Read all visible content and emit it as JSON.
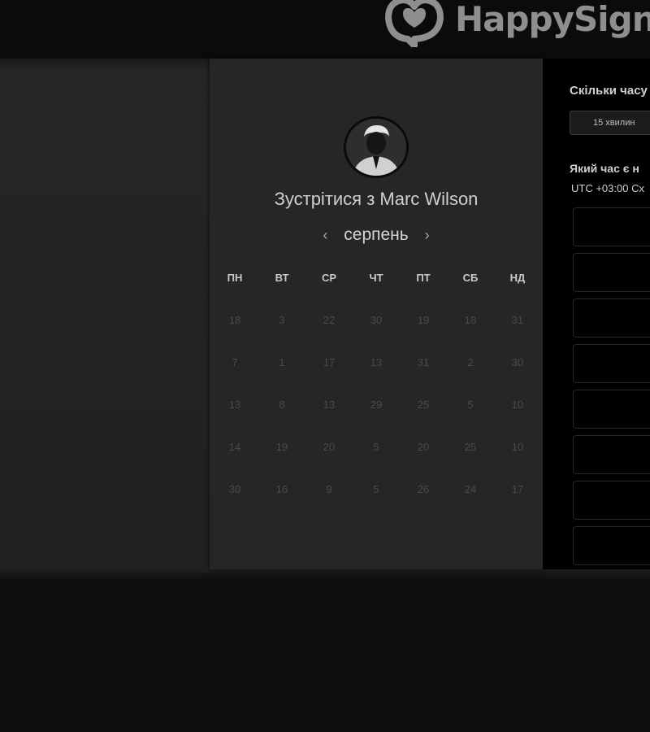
{
  "header": {
    "logo_text": "HappySign"
  },
  "card": {
    "title": "Зустрітися з Marc Wilson",
    "month": "серпень",
    "prev_arrow": "‹",
    "next_arrow": "›",
    "weekdays": [
      "ПН",
      "ВТ",
      "СР",
      "ЧТ",
      "ПТ",
      "СБ",
      "НД"
    ],
    "days": [
      [
        "18",
        "3",
        "22",
        "30",
        "19",
        "18",
        "31"
      ],
      [
        "7",
        "1",
        "17",
        "13",
        "31",
        "2",
        "30"
      ],
      [
        "13",
        "8",
        "13",
        "29",
        "25",
        "5",
        "10"
      ],
      [
        "14",
        "19",
        "20",
        "5",
        "20",
        "25",
        "10"
      ],
      [
        "30",
        "16",
        "9",
        "5",
        "26",
        "24",
        "17"
      ]
    ]
  },
  "panel": {
    "duration_question": "Скільки часу",
    "duration_value": "15 хвилин",
    "time_question": "Який час є н",
    "timezone": "UTC +03:00 Cx",
    "slot_count_visible": 8
  },
  "colors": {
    "background": "#0e0e0e",
    "card": "#262626",
    "panel": "#000000",
    "logo": "#8e8e8e"
  }
}
